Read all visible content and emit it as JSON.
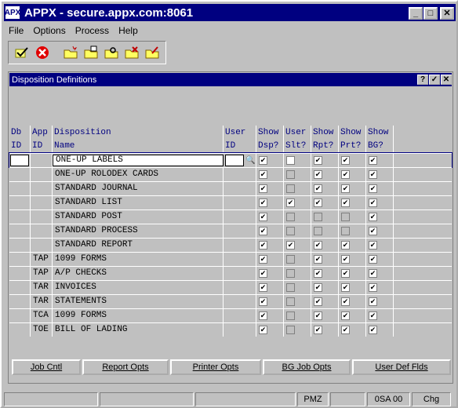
{
  "window": {
    "title": "APPX - secure.appx.com:8061",
    "app_icon": "APX"
  },
  "menu": [
    "File",
    "Options",
    "Process",
    "Help"
  ],
  "toolbar": {
    "icons": [
      "ok-check-icon",
      "cancel-icon",
      "new-record-icon",
      "open-folder-icon",
      "find-icon",
      "delete-icon",
      "change-icon"
    ]
  },
  "subwindow": {
    "title": "Disposition Definitions",
    "help": "?",
    "ok": "✓",
    "close": "✕"
  },
  "columns": {
    "db_id": [
      "Db",
      "ID"
    ],
    "app_id": [
      "App",
      "ID"
    ],
    "disposition": [
      "Disposition",
      "Name"
    ],
    "user_id": [
      "User",
      "ID"
    ],
    "show_dsp": [
      "Show",
      "Dsp?"
    ],
    "user_slt": [
      "User",
      "Slt?"
    ],
    "show_rpt": [
      "Show",
      "Rpt?"
    ],
    "show_prt": [
      "Show",
      "Prt?"
    ],
    "show_bg": [
      "Show",
      "BG?"
    ]
  },
  "rows": [
    {
      "app": "",
      "name": "ONE-UP LABELS",
      "dsp": true,
      "slt": false,
      "rpt": true,
      "prt": true,
      "bg": true
    },
    {
      "app": "",
      "name": "ONE-UP ROLODEX CARDS",
      "dsp": true,
      "slt": false,
      "rpt": true,
      "prt": true,
      "bg": true
    },
    {
      "app": "",
      "name": "STANDARD JOURNAL",
      "dsp": true,
      "slt": false,
      "rpt": true,
      "prt": true,
      "bg": true
    },
    {
      "app": "",
      "name": "STANDARD LIST",
      "dsp": true,
      "slt": true,
      "rpt": true,
      "prt": true,
      "bg": true
    },
    {
      "app": "",
      "name": "STANDARD POST",
      "dsp": true,
      "slt": false,
      "rpt": false,
      "prt": false,
      "bg": true
    },
    {
      "app": "",
      "name": "STANDARD PROCESS",
      "dsp": true,
      "slt": false,
      "rpt": false,
      "prt": false,
      "bg": true
    },
    {
      "app": "",
      "name": "STANDARD REPORT",
      "dsp": true,
      "slt": true,
      "rpt": true,
      "prt": true,
      "bg": true
    },
    {
      "app": "TAP",
      "name": "1099 FORMS",
      "dsp": true,
      "slt": false,
      "rpt": true,
      "prt": true,
      "bg": true
    },
    {
      "app": "TAP",
      "name": "A/P CHECKS",
      "dsp": true,
      "slt": false,
      "rpt": true,
      "prt": true,
      "bg": true
    },
    {
      "app": "TAR",
      "name": "INVOICES",
      "dsp": true,
      "slt": false,
      "rpt": true,
      "prt": true,
      "bg": true
    },
    {
      "app": "TAR",
      "name": "STATEMENTS",
      "dsp": true,
      "slt": false,
      "rpt": true,
      "prt": true,
      "bg": true
    },
    {
      "app": "TCA",
      "name": "1099 FORMS",
      "dsp": true,
      "slt": false,
      "rpt": true,
      "prt": true,
      "bg": true
    },
    {
      "app": "TOE",
      "name": "BILL OF LADING",
      "dsp": true,
      "slt": false,
      "rpt": true,
      "prt": true,
      "bg": true
    }
  ],
  "lookup_icon": "binoculars-icon",
  "buttons": [
    "Job Cntl",
    "Report Opts",
    "Printer Opts",
    "BG Job Opts",
    "User Def Flds"
  ],
  "status": {
    "s1": "",
    "s2": "",
    "s3": "",
    "s4": "PMZ",
    "s5": "",
    "s6": "0SA 00",
    "s7": "Chg"
  },
  "colors": {
    "title_bar": "#000080",
    "header_text": "#000080",
    "face": "#c0c0c0"
  }
}
